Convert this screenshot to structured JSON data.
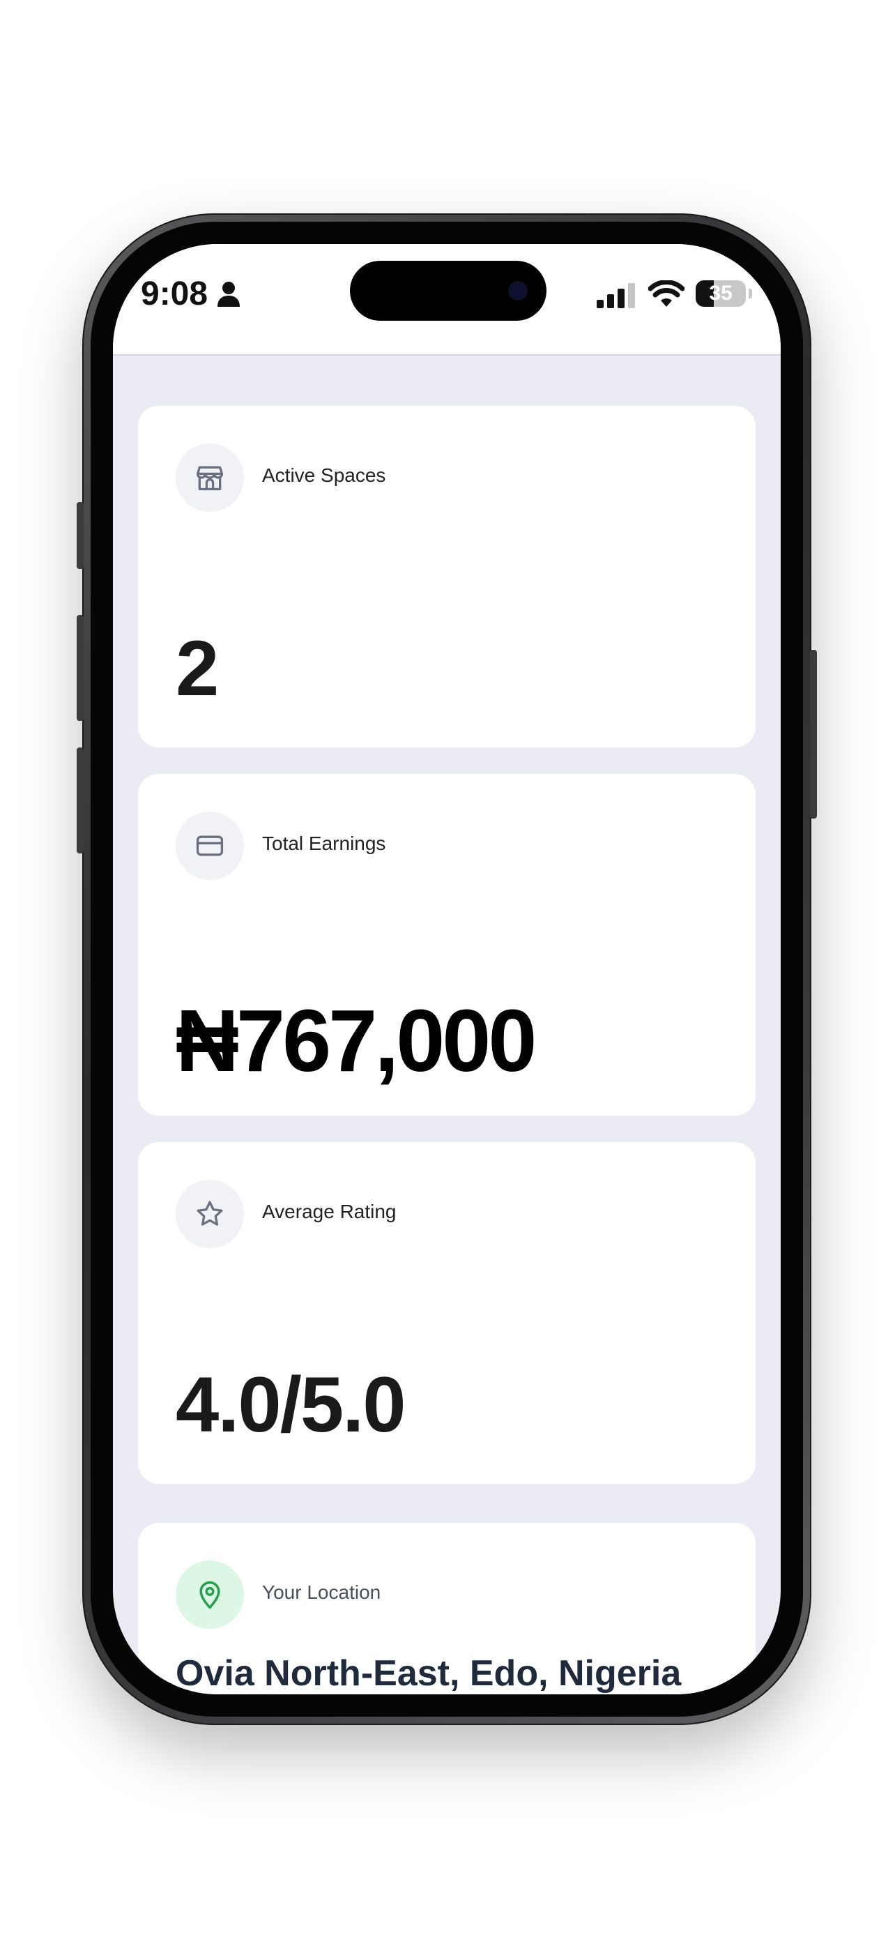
{
  "status_bar": {
    "time": "9:08",
    "battery_level": "35",
    "person_icon": "person-icon",
    "signal_icon": "cellular-signal-icon",
    "wifi_icon": "wifi-icon"
  },
  "cards": {
    "active_spaces": {
      "label": "Active Spaces",
      "value": "2",
      "icon": "storefront-icon"
    },
    "total_earnings": {
      "label": "Total Earnings",
      "value": "₦767,000",
      "icon": "credit-card-icon"
    },
    "average_rating": {
      "label": "Average Rating",
      "value": "4.0/5.0",
      "icon": "star-icon"
    },
    "location": {
      "label": "Your Location",
      "value": "Ovia North-East, Edo, Nigeria",
      "icon": "map-pin-icon"
    }
  },
  "colors": {
    "screen_background": "#ebecf3",
    "card_background": "#ffffff",
    "location_icon_accent": "#22a04b",
    "icon_gray": "#6b7080"
  }
}
